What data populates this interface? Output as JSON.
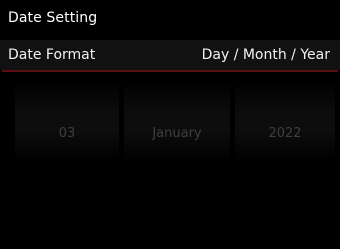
{
  "header": {
    "title": "Date Setting"
  },
  "setting": {
    "label": "Date Format",
    "value": "Day / Month / Year"
  },
  "picker": {
    "day": "03",
    "month": "January",
    "year": "2022"
  },
  "colors": {
    "background": "#000000",
    "accent_line": "#5a0f12",
    "inactive_text": "#3f3f3f"
  }
}
